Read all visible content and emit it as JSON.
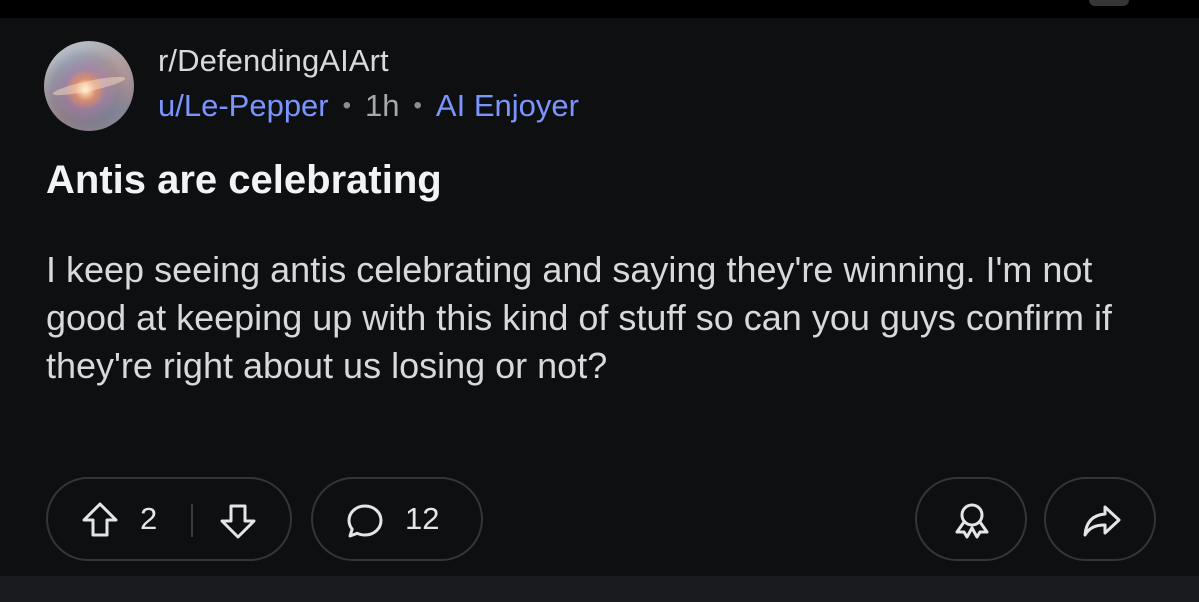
{
  "post": {
    "subreddit": "r/DefendingAIArt",
    "author": "u/Le-Pepper",
    "time": "1h",
    "flair": "AI Enjoyer",
    "title": "Antis are celebrating",
    "body": "I keep seeing antis celebrating and saying they're winning. I'm not good at keeping up with this kind of stuff so can you guys confirm if they're right about us losing or not?"
  },
  "actions": {
    "vote_count": "2",
    "comment_count": "12",
    "icons": {
      "upvote": "upvote-arrow-icon",
      "downvote": "downvote-arrow-icon",
      "comment": "speech-bubble-icon",
      "award": "award-ribbon-icon",
      "share": "share-arrow-icon"
    }
  },
  "colors": {
    "background": "#0e0f11",
    "accent_link": "#7b95ff",
    "text_primary": "#d7dadc",
    "pill_border": "#343538"
  }
}
